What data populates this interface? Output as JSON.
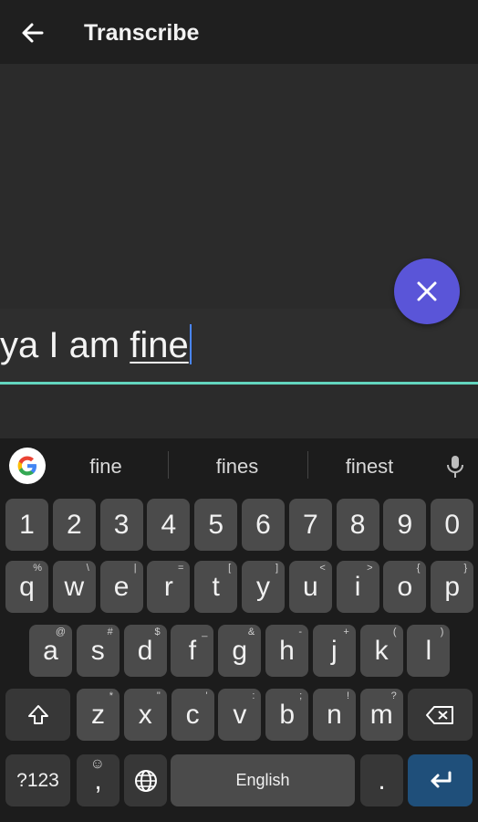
{
  "appbar": {
    "title": "Transcribe",
    "back_icon": "arrow-left-icon"
  },
  "transcript": {
    "plain": "ya I am ",
    "underlined": "fine"
  },
  "colors": {
    "accent": "#5a55d8",
    "underline": "#63d6bf",
    "caret": "#4a86ff",
    "enter": "#1f4f7a"
  },
  "keyboard": {
    "suggestions": [
      "fine",
      "fines",
      "finest"
    ],
    "numbers": [
      "1",
      "2",
      "3",
      "4",
      "5",
      "6",
      "7",
      "8",
      "9",
      "0"
    ],
    "row1": [
      {
        "k": "q",
        "h": "%"
      },
      {
        "k": "w",
        "h": "\\"
      },
      {
        "k": "e",
        "h": "|"
      },
      {
        "k": "r",
        "h": "="
      },
      {
        "k": "t",
        "h": "["
      },
      {
        "k": "y",
        "h": "]"
      },
      {
        "k": "u",
        "h": "<"
      },
      {
        "k": "i",
        "h": ">"
      },
      {
        "k": "o",
        "h": "{"
      },
      {
        "k": "p",
        "h": "}"
      }
    ],
    "row2": [
      {
        "k": "a",
        "h": "@"
      },
      {
        "k": "s",
        "h": "#"
      },
      {
        "k": "d",
        "h": "$"
      },
      {
        "k": "f",
        "h": "_"
      },
      {
        "k": "g",
        "h": "&"
      },
      {
        "k": "h",
        "h": "-"
      },
      {
        "k": "j",
        "h": "+"
      },
      {
        "k": "k",
        "h": "("
      },
      {
        "k": "l",
        "h": ")"
      }
    ],
    "row3": [
      {
        "k": "z",
        "h": "*"
      },
      {
        "k": "x",
        "h": "\""
      },
      {
        "k": "c",
        "h": "'"
      },
      {
        "k": "v",
        "h": ":"
      },
      {
        "k": "b",
        "h": ";"
      },
      {
        "k": "n",
        "h": "!"
      },
      {
        "k": "m",
        "h": "?"
      }
    ],
    "symbols_label": "?123",
    "comma": ",",
    "emoji_hint": "☺",
    "space_label": "English",
    "period": "."
  }
}
